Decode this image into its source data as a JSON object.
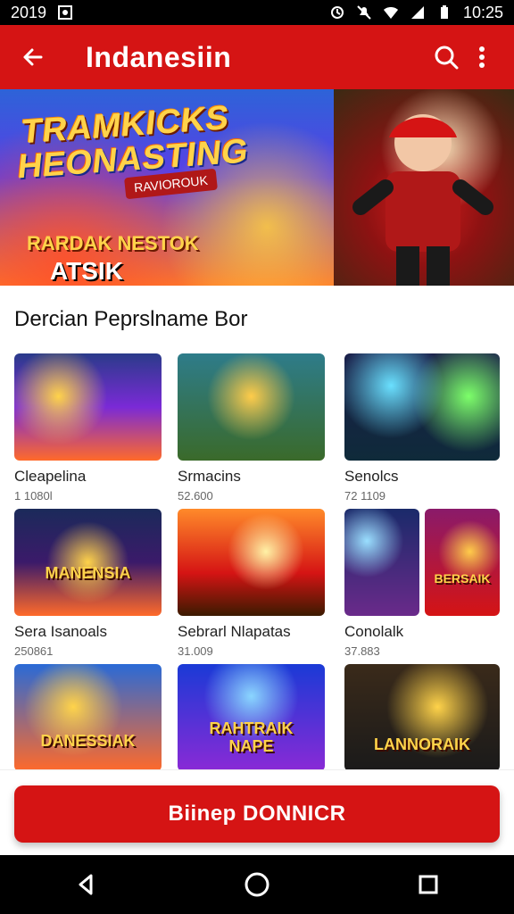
{
  "status_bar": {
    "time_left": "2019",
    "time_right": "10:25",
    "icons": [
      "gallery-icon",
      "alarm-icon",
      "silent-icon",
      "wifi-icon",
      "signal-icon",
      "battery-icon"
    ]
  },
  "app_bar": {
    "title": "Indanesiin",
    "icons": {
      "back": "back-arrow-icon",
      "search": "search-icon",
      "menu": "more-vert-icon"
    },
    "color": "#d51414"
  },
  "hero": {
    "line1": "TRAMKICKS",
    "line2": "HEONASTING",
    "ribbon": "RAVIOROUK",
    "sub": "RARDAK NESTOK",
    "sub2": "ATSIK"
  },
  "section": {
    "title": "Dercian Peprslname Bor"
  },
  "games": [
    {
      "name": "Cleapelina",
      "meta": "1 1080l"
    },
    {
      "name": "Srmacins",
      "meta": "52.600"
    },
    {
      "name": "Senolcs",
      "meta": "72 1109"
    },
    {
      "name": "Sera Isanoals",
      "meta": "250861"
    },
    {
      "name": "Sebrarl Nlapatas",
      "meta": "31.009"
    },
    {
      "name": "Conolalk",
      "meta": "37.883"
    }
  ],
  "row3_overlays": {
    "card1": "DANESSIAK",
    "card2_line1": "RAHTRAIK",
    "card2_line2": "NAPE",
    "card3": "LANNORAIK"
  },
  "row2_overlays": {
    "card1": "MANENSIA",
    "card3": "BERSAIK"
  },
  "cta": {
    "label": "Biinep DONNICR",
    "color": "#d51414"
  },
  "nav": {
    "back": "back-icon",
    "home": "home-icon",
    "recents": "recents-icon"
  }
}
